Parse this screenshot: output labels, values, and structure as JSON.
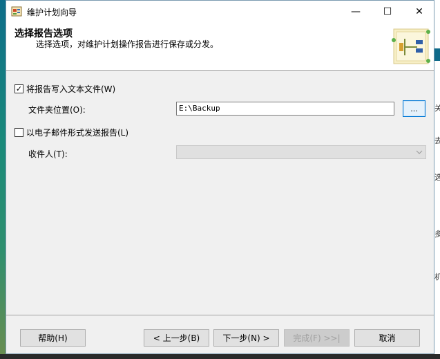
{
  "window": {
    "title": "维护计划向导",
    "min_glyph": "—",
    "max_glyph": "☐",
    "close_glyph": "✕"
  },
  "header": {
    "title": "选择报告选项",
    "subtitle": "选择选项，对维护计划操作报告进行保存或分发。"
  },
  "options": {
    "write_text_file": {
      "label": "将报告写入文本文件(W)",
      "checked": true,
      "mark": "✓"
    },
    "folder_location_label": "文件夹位置(O):",
    "folder_location_value": "E:\\Backup",
    "browse_label": "...",
    "email_report": {
      "label": "以电子邮件形式发送报告(L)",
      "checked": false,
      "mark": ""
    },
    "recipient_label": "收件人(T):",
    "recipient_value": ""
  },
  "footer": {
    "help": "帮助(H)",
    "back": "< 上一步(B)",
    "next": "下一步(N) >",
    "finish": "完成(F) >>|",
    "cancel": "取消"
  },
  "background_fragments": {
    "f1": "关",
    "f2": "去",
    "f3": "选",
    "f4": "多",
    "f5": "机"
  }
}
